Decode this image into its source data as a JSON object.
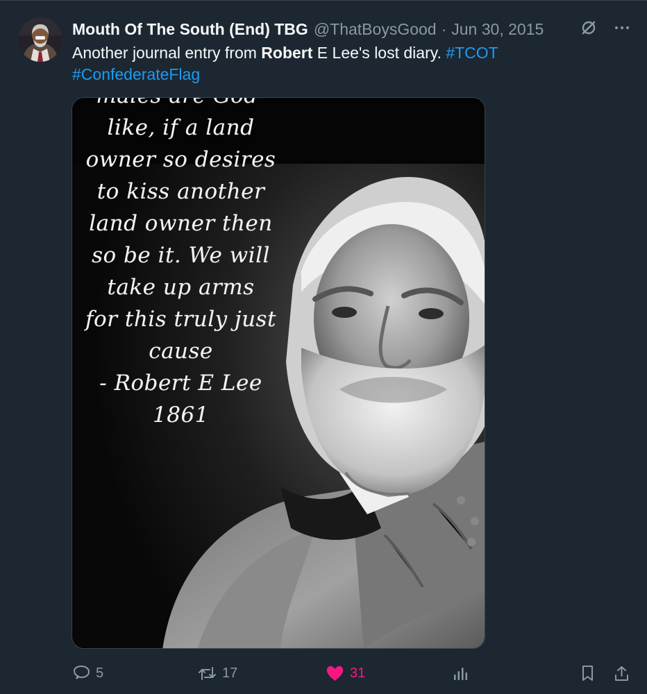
{
  "tweet": {
    "display_name": "Mouth Of The South (End) TBG",
    "handle": "@ThatBoysGood",
    "separator": "·",
    "date": "Jun 30, 2015",
    "text_prefix": "Another journal entry from ",
    "text_bold": "Robert",
    "text_suffix": " E Lee's lost diary. ",
    "hashtags": [
      "#TCOT",
      "#ConfederateFlag"
    ]
  },
  "top_actions": {
    "grok_icon": "slash-circle-icon",
    "more_icon": "more-icon",
    "more_label": "···"
  },
  "image": {
    "quote_lines": [
      "males are God-",
      "like, if a land",
      "owner so desires",
      "to kiss another",
      "land owner then",
      "so be it. We will",
      "take up arms",
      "for this truly just",
      "cause",
      "- Robert E Lee",
      "1861"
    ]
  },
  "actions": {
    "reply_count": "5",
    "retweet_count": "17",
    "like_count": "31",
    "views_label": "",
    "bookmark_label": "",
    "share_label": ""
  },
  "colors": {
    "background": "#1c2732",
    "accent": "#1d9bf0",
    "like": "#f91880",
    "secondary_text": "#8b98a5"
  }
}
